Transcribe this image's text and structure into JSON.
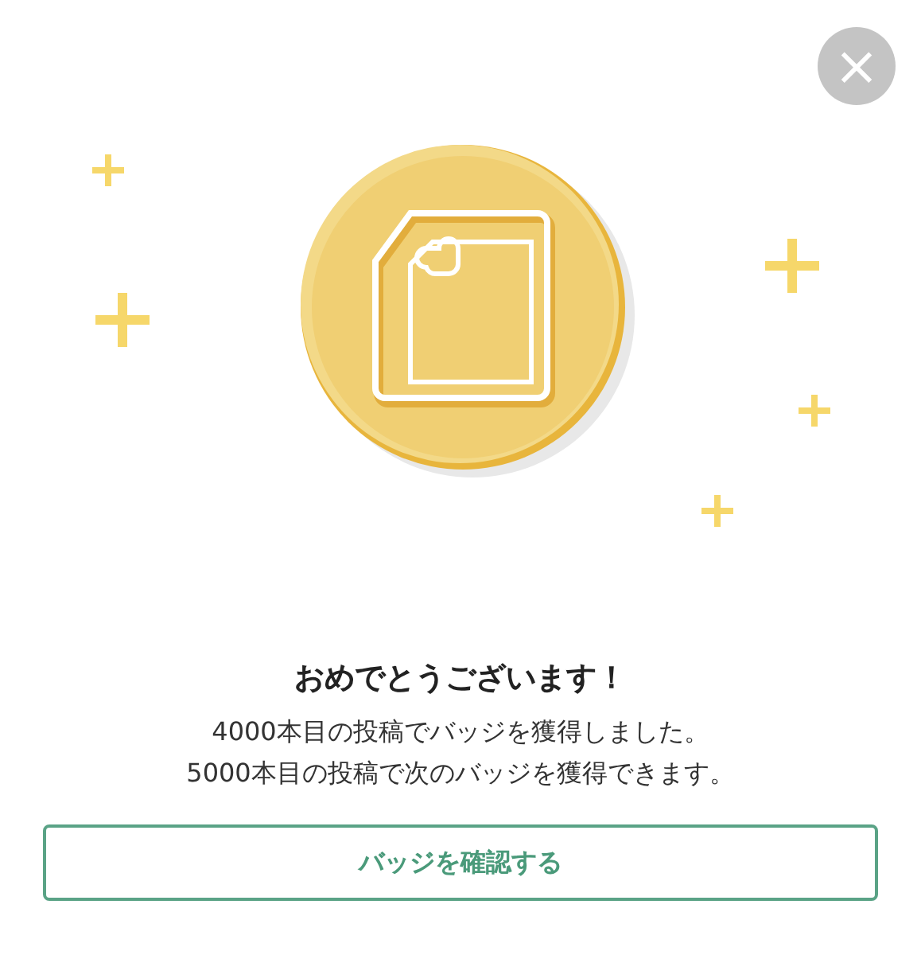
{
  "close_button": {
    "label": "×"
  },
  "title": "おめでとうございます！",
  "messages": [
    "4000本目の投稿でバッジを獲得しました。",
    "5000本目の投稿で次のバッジを獲得できます。"
  ],
  "button": {
    "label": "バッジを確認する"
  }
}
